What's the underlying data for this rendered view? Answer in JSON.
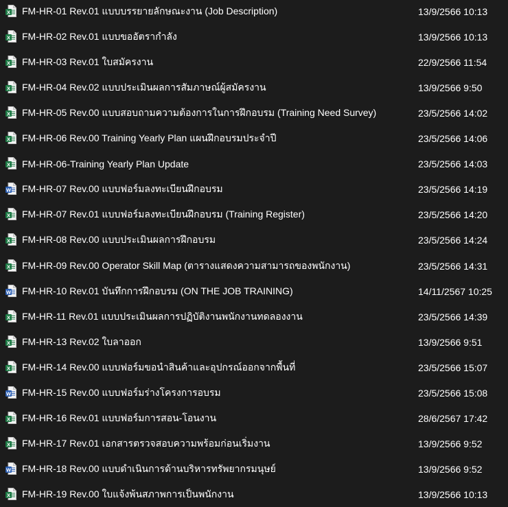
{
  "files": [
    {
      "name": "FM-HR-01 Rev.01 แบบบรรยายลักษณะงาน (Job Description)",
      "modified": "13/9/2566 10:13",
      "icon": "excel-file-icon"
    },
    {
      "name": "FM-HR-02 Rev.01 แบบขออัตรากำลัง",
      "modified": "13/9/2566 10:13",
      "icon": "excel-file-icon"
    },
    {
      "name": "FM-HR-03 Rev.01 ใบสมัครงาน",
      "modified": "22/9/2566 11:54",
      "icon": "excel-file-icon"
    },
    {
      "name": "FM-HR-04 Rev.02 แบบประเมินผลการสัมภาษณ์ผู้สมัครงาน",
      "modified": "13/9/2566 9:50",
      "icon": "excel-file-icon"
    },
    {
      "name": "FM-HR-05 Rev.00 แบบสอบถามความต้องการในการฝึกอบรม (Training Need Survey)",
      "modified": "23/5/2566 14:02",
      "icon": "excel-file-icon"
    },
    {
      "name": "FM-HR-06 Rev.00 Training Yearly Plan แผนฝึกอบรมประจำปี",
      "modified": "23/5/2566 14:06",
      "icon": "excel-file-icon"
    },
    {
      "name": "FM-HR-06-Training Yearly Plan Update",
      "modified": "23/5/2566 14:03",
      "icon": "excel-file-icon"
    },
    {
      "name": "FM-HR-07 Rev.00 แบบฟอร์มลงทะเบียนฝึกอบรม",
      "modified": "23/5/2566 14:19",
      "icon": "word-file-icon"
    },
    {
      "name": "FM-HR-07 Rev.01 แบบฟอร์มลงทะเบียนฝึกอบรม (Training Register)",
      "modified": "23/5/2566 14:20",
      "icon": "excel-file-icon"
    },
    {
      "name": "FM-HR-08 Rev.00 แบบประเมินผลการฝึกอบรม",
      "modified": "23/5/2566 14:24",
      "icon": "excel-file-icon"
    },
    {
      "name": "FM-HR-09 Rev.00 Operator Skill Map (ตารางแสดงความสามารถของพนักงาน)",
      "modified": "23/5/2566 14:31",
      "icon": "excel-file-icon"
    },
    {
      "name": "FM-HR-10 Rev.01 บันทึกการฝึกอบรม (ON THE JOB TRAINING)",
      "modified": "14/11/2567 10:25",
      "icon": "word-file-icon"
    },
    {
      "name": "FM-HR-11 Rev.01 แบบประเมินผลการปฏิบัติงานพนักงานทดลองงาน",
      "modified": "23/5/2566 14:39",
      "icon": "excel-file-icon"
    },
    {
      "name": "FM-HR-13 Rev.02 ใบลาออก",
      "modified": "13/9/2566 9:51",
      "icon": "excel-file-icon"
    },
    {
      "name": "FM-HR-14 Rev.00 แบบฟอร์มขอนำสินค้าและอุปกรณ์ออกจากพื้นที่",
      "modified": "23/5/2566 15:07",
      "icon": "excel-file-icon"
    },
    {
      "name": "FM-HR-15 Rev.00 แบบฟอร์มร่างโครงการอบรม",
      "modified": "23/5/2566 15:08",
      "icon": "word-file-icon"
    },
    {
      "name": "FM-HR-16 Rev.01 แบบฟอร์มการสอน-โอนงาน",
      "modified": "28/6/2567 17:42",
      "icon": "excel-file-icon"
    },
    {
      "name": "FM-HR-17 Rev.01 เอกสารตรวจสอบความพร้อมก่อนเริ่มงาน",
      "modified": "13/9/2566 9:52",
      "icon": "excel-file-icon"
    },
    {
      "name": "FM-HR-18 Rev.00 แบบดำเนินการด้านบริหารทรัพยากรมนุษย์",
      "modified": "13/9/2566 9:52",
      "icon": "word-file-icon"
    },
    {
      "name": "FM-HR-19 Rev.00 ใบแจ้งพ้นสภาพการเป็นพนักงาน",
      "modified": "13/9/2566 10:13",
      "icon": "excel-file-icon"
    }
  ],
  "colors": {
    "background": "#1c1c1c",
    "text": "#ffffff",
    "excel_green": "#1d7a45",
    "word_blue": "#2b5fb4"
  }
}
